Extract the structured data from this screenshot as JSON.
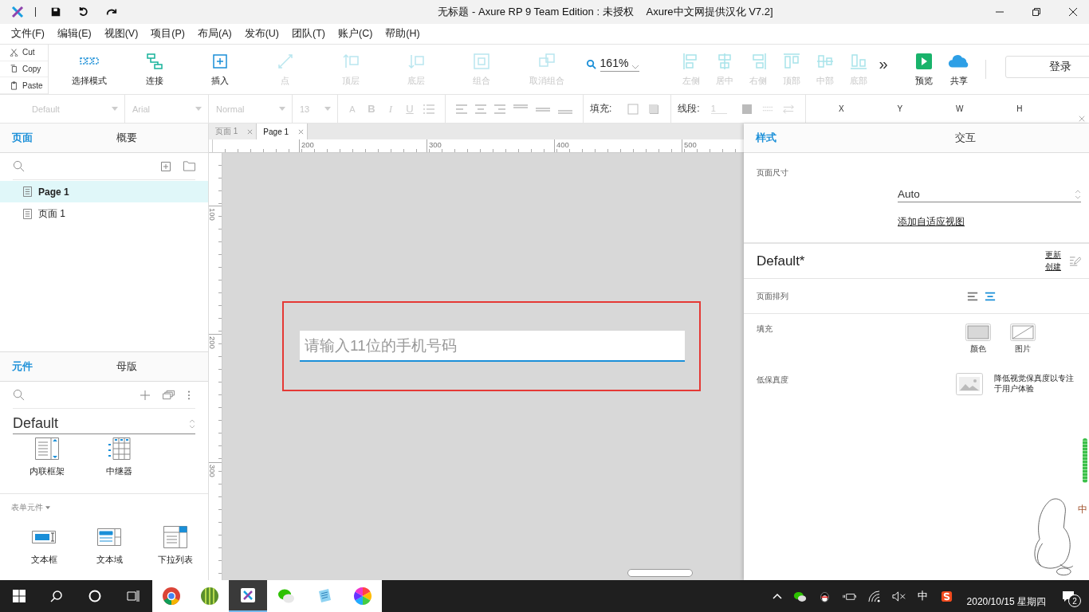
{
  "window": {
    "title": "无标题 - Axure RP 9 Team Edition : 未授权",
    "subtitle": "Axure中文网提供汉化  V7.2]"
  },
  "menu": [
    "文件(F)",
    "编辑(E)",
    "视图(V)",
    "项目(P)",
    "布局(A)",
    "发布(U)",
    "团队(T)",
    "账户(C)",
    "帮助(H)"
  ],
  "clipboard": [
    {
      "label": "Cut",
      "kind": "cut"
    },
    {
      "label": "Copy",
      "kind": "copy"
    },
    {
      "label": "Paste",
      "kind": "paste"
    }
  ],
  "tools": [
    {
      "label": "选择模式",
      "kind": "select",
      "disabled": false
    },
    {
      "label": "连接",
      "kind": "connect",
      "disabled": false
    },
    {
      "label": "插入",
      "kind": "insert",
      "disabled": false
    },
    {
      "label": "点",
      "kind": "point",
      "disabled": true
    },
    {
      "label": "顶层",
      "kind": "front",
      "disabled": true
    },
    {
      "label": "底层",
      "kind": "back",
      "disabled": true
    },
    {
      "label": "组合",
      "kind": "group",
      "disabled": true
    },
    {
      "label": "取消组合",
      "kind": "ungroup",
      "disabled": true
    }
  ],
  "zoom": "161%",
  "align_tools": [
    {
      "label": "左侧",
      "kind": "align_left",
      "disabled": true
    },
    {
      "label": "居中",
      "kind": "align_center",
      "disabled": true
    },
    {
      "label": "右侧",
      "kind": "align_right",
      "disabled": true
    },
    {
      "label": "顶部",
      "kind": "top",
      "disabled": true
    },
    {
      "label": "中部",
      "kind": "middle",
      "disabled": true
    },
    {
      "label": "底部",
      "kind": "bottom",
      "disabled": true
    }
  ],
  "more": "»",
  "publish_tools": [
    {
      "label": "预览",
      "kind": "preview"
    },
    {
      "label": "共享",
      "kind": "share"
    }
  ],
  "login_button": "登录",
  "format_bar": {
    "dropdowns": [
      "Default",
      "Arial",
      "Normal",
      "13"
    ],
    "font_buttons": [
      "A",
      "B",
      "I",
      "U"
    ],
    "fill_label": "填充:",
    "line_label": "线段:",
    "line_value": "1",
    "coords": [
      "X",
      "Y",
      "W",
      "H"
    ]
  },
  "pages_panel": {
    "tabs": [
      {
        "label": "页面",
        "selected": true
      },
      {
        "label": "概要",
        "selected": false
      }
    ],
    "pages": [
      {
        "label": "Page 1",
        "selected": true
      },
      {
        "label": "页面 1",
        "selected": false
      }
    ]
  },
  "library_panel": {
    "tabs": [
      {
        "label": "元件",
        "selected": true
      },
      {
        "label": "母版",
        "selected": false
      }
    ],
    "library": "Default",
    "widgets": [
      {
        "label": "内联框架",
        "kind": "iframe"
      },
      {
        "label": "中继器",
        "kind": "repeater"
      }
    ],
    "section": "表单元件",
    "form_widgets": [
      {
        "label": "文本框",
        "kind": "textbox"
      },
      {
        "label": "文本域",
        "kind": "textarea"
      },
      {
        "label": "下拉列表",
        "kind": "dropdown"
      }
    ]
  },
  "doc_tabs": [
    {
      "label": "页面 1",
      "selected": false
    },
    {
      "label": "Page 1",
      "selected": true
    }
  ],
  "ruler": {
    "horizontal": [
      "200",
      "300",
      "400",
      "500"
    ],
    "vertical": [
      "100",
      "200",
      "300"
    ]
  },
  "canvas": {
    "textbox_placeholder": "请输入11位的手机号码"
  },
  "style_panel": {
    "tabs": [
      {
        "label": "样式",
        "selected": true
      },
      {
        "label": "交互",
        "selected": false
      }
    ],
    "page_size_label": "页面尺寸",
    "page_size": "Auto",
    "adaptive_link": "添加自适应视图",
    "style_name": "Default*",
    "update_link": "更新",
    "create_link": "创建",
    "arrange_label": "页面排列",
    "arrange": [
      {
        "kind": "left",
        "selected": false
      },
      {
        "kind": "center",
        "selected": true
      }
    ],
    "fill_label": "填充",
    "fill_options": [
      {
        "label": "颜色",
        "kind": "color"
      },
      {
        "label": "图片",
        "kind": "image"
      }
    ],
    "fidelity_label": "低保真度",
    "fidelity_text": "降低视觉保真度以专注于用户体验"
  },
  "ime_overlay": {
    "text": "中"
  },
  "taskbar": {
    "apps": [
      {
        "kind": "search"
      },
      {
        "kind": "cortana"
      },
      {
        "kind": "taskview"
      },
      {
        "kind": "chrome",
        "selected": false
      },
      {
        "kind": "bamboo",
        "selected": false
      },
      {
        "kind": "axure",
        "selected": true
      },
      {
        "kind": "wechat",
        "selected": false
      },
      {
        "kind": "notepad",
        "selected": false
      },
      {
        "kind": "colorwheel",
        "selected": false
      }
    ],
    "ime": "中",
    "date": "2020/10/15 星期四",
    "notifications": "2"
  }
}
